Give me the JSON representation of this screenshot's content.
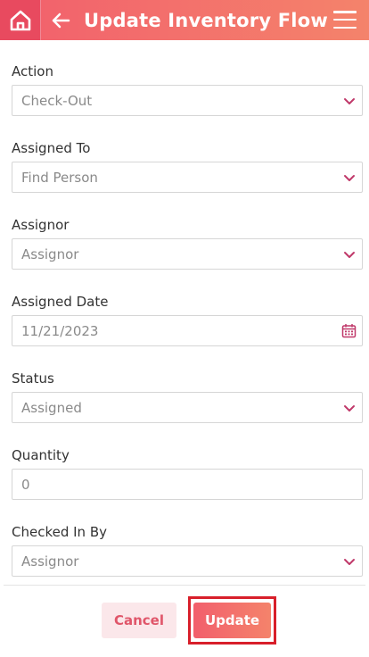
{
  "header": {
    "title": "Update Inventory Flow",
    "home_icon": "home-icon",
    "back_icon": "arrow-left-icon",
    "menu_icon": "hamburger-menu-icon"
  },
  "colors": {
    "accent": "#f25f6c",
    "accent_light": "#f4836b",
    "home_bg": "#e84a5f",
    "chevron": "#c0396a",
    "focus_outline": "#d81f2a"
  },
  "form": {
    "action": {
      "label": "Action",
      "value": "Check-Out"
    },
    "assigned_to": {
      "label": "Assigned To",
      "placeholder": "Find Person"
    },
    "assignor": {
      "label": "Assignor",
      "placeholder": "Assignor"
    },
    "assigned_date": {
      "label": "Assigned Date",
      "value": "11/21/2023"
    },
    "status": {
      "label": "Status",
      "value": "Assigned"
    },
    "quantity": {
      "label": "Quantity",
      "placeholder": "0"
    },
    "checked_in_by": {
      "label": "Checked In By",
      "placeholder": "Assignor"
    }
  },
  "footer": {
    "cancel_label": "Cancel",
    "update_label": "Update"
  }
}
